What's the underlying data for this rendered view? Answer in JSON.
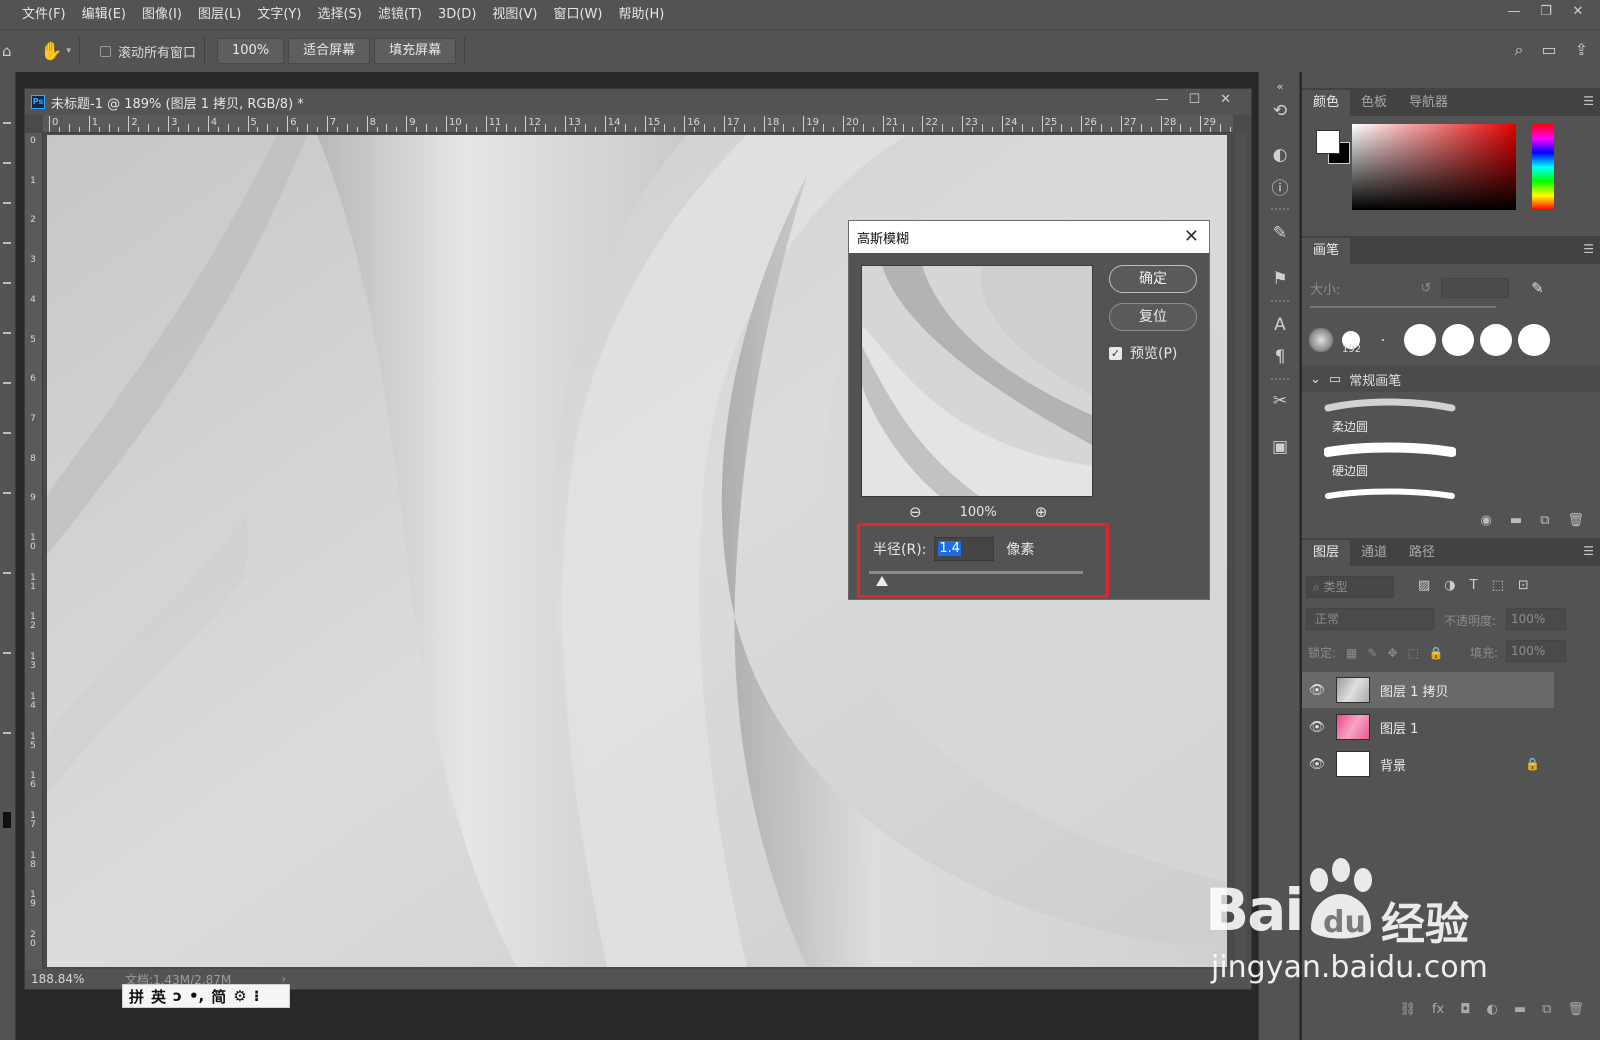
{
  "app": {
    "menu": [
      "文件(F)",
      "编辑(E)",
      "图像(I)",
      "图层(L)",
      "文字(Y)",
      "选择(S)",
      "滤镜(T)",
      "3D(D)",
      "视图(V)",
      "窗口(W)",
      "帮助(H)"
    ],
    "window_controls": [
      "—",
      "❐",
      "✕"
    ]
  },
  "options_bar": {
    "scroll_all_label": "滚动所有窗口",
    "zoom_100_label": "100%",
    "fit_screen_label": "适合屏幕",
    "fill_screen_label": "填充屏幕"
  },
  "document": {
    "badge": "Ps",
    "title": "未标题-1 @ 189% (图层 1 拷贝, RGB/8) *",
    "controls": [
      "—",
      "☐",
      "✕"
    ],
    "ruler_h": [
      "0",
      "1",
      "2",
      "3",
      "4",
      "5",
      "6",
      "7",
      "8",
      "9",
      "10",
      "11",
      "12",
      "13",
      "14",
      "15",
      "16",
      "17",
      "18",
      "19",
      "20",
      "21",
      "22",
      "23",
      "24",
      "25",
      "26",
      "27",
      "28",
      "29"
    ],
    "ruler_v": [
      "0",
      "1",
      "2",
      "3",
      "4",
      "5",
      "6",
      "7",
      "8",
      "9",
      "1 0",
      "1 1",
      "1 2",
      "1 3",
      "1 4",
      "1 5",
      "1 6",
      "1 7",
      "1 8",
      "1 9",
      "2 0"
    ],
    "status_zoom": "188.84%",
    "status_doc": "文档:1.43M/2.87M",
    "status_arrow": "›"
  },
  "ime_bar": {
    "items": [
      "拼",
      "英",
      "ↄ",
      "•,",
      "简",
      "⚙",
      "⁝"
    ]
  },
  "dialog": {
    "title": "高斯模糊",
    "close": "✕",
    "ok_label": "确定",
    "reset_label": "复位",
    "preview_label": "预览(P)",
    "preview_checked": true,
    "zoom_out_icon": "zoom-out-icon",
    "zoom_in_icon": "zoom-in-icon",
    "preview_zoom": "100%",
    "radius_label": "半径(R):",
    "radius_value": "1.4",
    "radius_unit": "像素",
    "slider_value_fraction": 0.06,
    "highlight_color": "#e2262b"
  },
  "panels": {
    "color_tabs": [
      "颜色",
      "色板",
      "导航器"
    ],
    "brush_tab": "画笔",
    "brush_size_label": "大小:",
    "brush_tip_number": "192",
    "brush_folder": "常规画笔",
    "brush_presets": [
      "柔边圆",
      "硬边圆"
    ],
    "layer_tabs": [
      "图层",
      "通道",
      "路径"
    ],
    "layer_filter": "类型",
    "blend_mode": "正常",
    "opacity_label": "不透明度:",
    "opacity_value": "100%",
    "lock_label": "锁定:",
    "fill_label": "填充:",
    "fill_value": "100%",
    "layers": [
      {
        "name": "图层 1 拷贝",
        "selected": true,
        "thumb": "gray"
      },
      {
        "name": "图层 1",
        "selected": false,
        "thumb": "pink"
      },
      {
        "name": "背景",
        "selected": false,
        "thumb": "white",
        "locked": true
      }
    ]
  },
  "watermark": {
    "brand": "Bai",
    "brand_cn": "经验",
    "url": "jingyan.baidu.com"
  }
}
